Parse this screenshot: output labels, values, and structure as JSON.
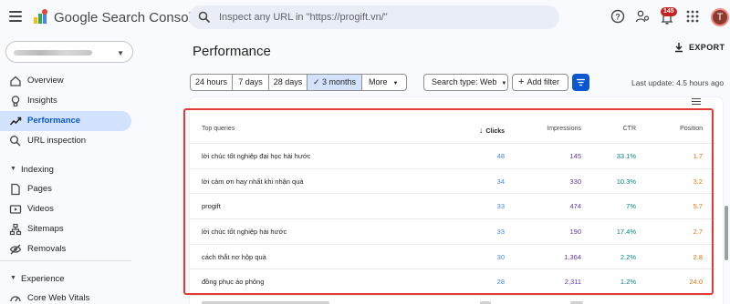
{
  "app": {
    "title": "Google Search Console",
    "search_placeholder": "Inspect any URL in \"https://progift.vn/\"",
    "notification_count": "145",
    "avatar_letter": "T"
  },
  "sidebar": {
    "items": [
      {
        "label": "Overview",
        "icon": "home-icon"
      },
      {
        "label": "Insights",
        "icon": "lightbulb-icon"
      },
      {
        "label": "Performance",
        "icon": "trending-up-icon"
      },
      {
        "label": "URL inspection",
        "icon": "search-icon"
      }
    ],
    "section_indexing": "Indexing",
    "indexing_items": [
      {
        "label": "Pages",
        "icon": "pages-icon"
      },
      {
        "label": "Videos",
        "icon": "videos-icon"
      },
      {
        "label": "Sitemaps",
        "icon": "sitemap-icon"
      },
      {
        "label": "Removals",
        "icon": "removals-icon"
      }
    ],
    "section_experience": "Experience",
    "experience_items": [
      {
        "label": "Core Web Vitals",
        "icon": "gauge-icon"
      }
    ]
  },
  "main": {
    "title": "Performance",
    "export_label": "EXPORT",
    "date_ranges": [
      "24 hours",
      "7 days",
      "28 days",
      "3 months",
      "More"
    ],
    "selected_range": "3 months",
    "search_type": "Search type: Web",
    "add_filter": "Add filter",
    "last_update": "Last update: 4.5 hours ago"
  },
  "table": {
    "headers": {
      "query": "Top queries",
      "clicks": "Clicks",
      "impressions": "Impressions",
      "ctr": "CTR",
      "position": "Position"
    },
    "rows": [
      {
        "query": "lời chúc tốt nghiệp đại học hài hước",
        "clicks": "48",
        "impressions": "145",
        "ctr": "33.1%",
        "position": "1.7"
      },
      {
        "query": "lời cảm ơn hay nhất khi nhận quà",
        "clicks": "34",
        "impressions": "330",
        "ctr": "10.3%",
        "position": "3.2"
      },
      {
        "query": "progift",
        "clicks": "33",
        "impressions": "474",
        "ctr": "7%",
        "position": "5.7"
      },
      {
        "query": "lời chúc tốt nghiệp hài hước",
        "clicks": "33",
        "impressions": "190",
        "ctr": "17.4%",
        "position": "2.7"
      },
      {
        "query": "cách thắt nơ hộp quà",
        "clicks": "30",
        "impressions": "1,364",
        "ctr": "2.2%",
        "position": "2.8"
      },
      {
        "query": "đồng phục áo phông",
        "clicks": "28",
        "impressions": "2,311",
        "ctr": "1.2%",
        "position": "24.0"
      }
    ]
  },
  "colors": {
    "accent": "#0b57d0",
    "clicks": "#4285f4",
    "impressions": "#5e35b1",
    "ctr": "#00897b",
    "position": "#e8710a",
    "highlight_border": "#e53935"
  }
}
